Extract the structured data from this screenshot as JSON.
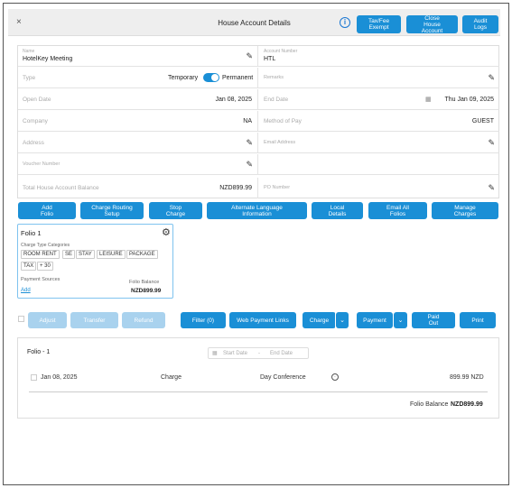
{
  "header": {
    "close": "×",
    "title": "House Account Details",
    "info": "i",
    "tax_fee_exempt": "Tax/Fee\nExempt",
    "close_house_account": "Close\nHouse\nAccount",
    "audit_logs": "Audit\nLogs"
  },
  "form": {
    "name_label": "Name",
    "name_value": "HotelKey Meeting",
    "account_number_label": "Account Number",
    "account_number_value": "HTL",
    "type_label": "Type",
    "type_temporary": "Temporary",
    "type_permanent": "Permanent",
    "remarks_label": "Remarks",
    "open_date_label": "Open Date",
    "open_date_value": "Jan 08, 2025",
    "end_date_label": "End Date",
    "end_date_value": "Thu Jan 09, 2025",
    "company_label": "Company",
    "company_value": "NA",
    "method_of_pay_label": "Method of Pay",
    "method_of_pay_value": "GUEST",
    "address_label": "Address",
    "email_label": "Email Address",
    "voucher_label": "Voucher Number",
    "balance_label": "Total House Account Balance",
    "balance_value": "NZD899.99",
    "po_label": "PO Number"
  },
  "actions": {
    "add_folio": "Add\nFolio",
    "charge_routing": "Charge Routing\nSetup",
    "stop_charge": "Stop\nCharge",
    "alt_language": "Alternate Language\nInformation",
    "local_details": "Local\nDetails",
    "email_all": "Email All\nFolios",
    "manage_charges": "Manage\nCharges"
  },
  "folio_card": {
    "title": "Folio 1",
    "categories_label": "Charge Type Categories",
    "chips": [
      "ROOM RENT",
      "SE",
      "STAY",
      "LEISURE",
      "PACKAGE",
      "TAX",
      "+ 30"
    ],
    "payment_sources_label": "Payment Sources",
    "add_link": "Add",
    "folio_balance_label": "Folio Balance",
    "folio_balance_value": "NZD899.99"
  },
  "toolbar": {
    "adjust": "Adjust",
    "transfer": "Transfer",
    "refund": "Refund",
    "filter": "Filter (0)",
    "web_payment_links": "Web Payment Links",
    "charge": "Charge",
    "payment": "Payment",
    "paid_out": "Paid\nOut",
    "print": "Print"
  },
  "folio_panel": {
    "title": "Folio - 1",
    "start_date_placeholder": "Start Date",
    "date_sep": "-",
    "end_date_placeholder": "End Date",
    "row_date": "Jan 08, 2025",
    "row_type": "Charge",
    "row_desc": "Day Conference",
    "row_amount": "899.99 NZD",
    "balance_label": "Folio Balance",
    "balance_value": "NZD899.99"
  },
  "colors": {
    "accent": "#1a8fd6",
    "accent_disabled": "#a9d2ee"
  }
}
